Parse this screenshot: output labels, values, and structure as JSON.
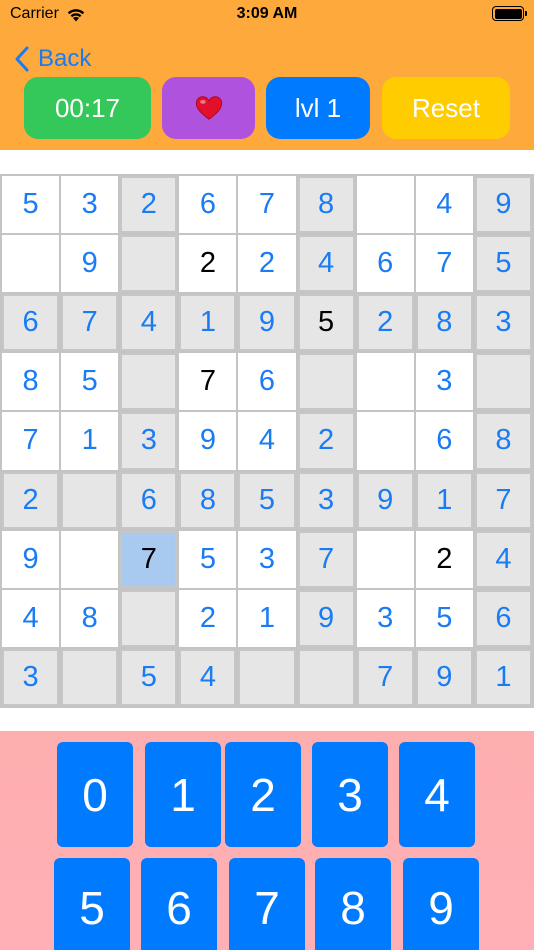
{
  "status_bar": {
    "carrier": "Carrier",
    "time": "3:09 AM"
  },
  "nav": {
    "back_label": "Back"
  },
  "toolbar": {
    "timer": "00:17",
    "favorite_icon": "heart-icon",
    "level": "lvl 1",
    "reset": "Reset"
  },
  "colors": {
    "header": "#fea93b",
    "timer": "#34c759",
    "favorite": "#af52de",
    "level": "#007aff",
    "reset": "#ffcc00",
    "entry_text": "#1a7cf5",
    "given_text": "#000000",
    "selected_cell": "#a8c9f0",
    "shaded_cell": "#e6e6e6",
    "keypad_bg": "#fdaeae",
    "key": "#007aff"
  },
  "board": {
    "rows": [
      [
        {
          "v": "5"
        },
        {
          "v": "3"
        },
        {
          "v": "2",
          "shade": true
        },
        {
          "v": "6"
        },
        {
          "v": "7"
        },
        {
          "v": "8",
          "shade": true
        },
        {
          "v": ""
        },
        {
          "v": "4"
        },
        {
          "v": "9",
          "shade": true
        }
      ],
      [
        {
          "v": ""
        },
        {
          "v": "9"
        },
        {
          "v": "",
          "shade": true
        },
        {
          "v": "2",
          "given": true
        },
        {
          "v": "2"
        },
        {
          "v": "4",
          "shade": true
        },
        {
          "v": "6"
        },
        {
          "v": "7"
        },
        {
          "v": "5",
          "shade": true
        }
      ],
      [
        {
          "v": "6",
          "shade": true
        },
        {
          "v": "7",
          "shade": true
        },
        {
          "v": "4",
          "shade": true
        },
        {
          "v": "1",
          "shade": true
        },
        {
          "v": "9",
          "shade": true
        },
        {
          "v": "5",
          "shade": true,
          "given": true
        },
        {
          "v": "2",
          "shade": true
        },
        {
          "v": "8",
          "shade": true
        },
        {
          "v": "3",
          "shade": true
        }
      ],
      [
        {
          "v": "8"
        },
        {
          "v": "5"
        },
        {
          "v": "",
          "shade": true
        },
        {
          "v": "7",
          "given": true
        },
        {
          "v": "6"
        },
        {
          "v": "",
          "shade": true
        },
        {
          "v": ""
        },
        {
          "v": "3"
        },
        {
          "v": "",
          "shade": true
        }
      ],
      [
        {
          "v": "7"
        },
        {
          "v": "1"
        },
        {
          "v": "3",
          "shade": true
        },
        {
          "v": "9"
        },
        {
          "v": "4"
        },
        {
          "v": "2",
          "shade": true
        },
        {
          "v": ""
        },
        {
          "v": "6"
        },
        {
          "v": "8",
          "shade": true
        }
      ],
      [
        {
          "v": "2",
          "shade": true
        },
        {
          "v": "",
          "shade": true
        },
        {
          "v": "6",
          "shade": true
        },
        {
          "v": "8",
          "shade": true
        },
        {
          "v": "5",
          "shade": true
        },
        {
          "v": "3",
          "shade": true
        },
        {
          "v": "9",
          "shade": true
        },
        {
          "v": "1",
          "shade": true
        },
        {
          "v": "7",
          "shade": true
        }
      ],
      [
        {
          "v": "9"
        },
        {
          "v": ""
        },
        {
          "v": "7",
          "given": true,
          "selected": true
        },
        {
          "v": "5"
        },
        {
          "v": "3"
        },
        {
          "v": "7",
          "shade": true
        },
        {
          "v": ""
        },
        {
          "v": "2",
          "given": true
        },
        {
          "v": "4",
          "shade": true
        }
      ],
      [
        {
          "v": "4"
        },
        {
          "v": "8"
        },
        {
          "v": "",
          "shade": true
        },
        {
          "v": "2"
        },
        {
          "v": "1"
        },
        {
          "v": "9",
          "shade": true
        },
        {
          "v": "3"
        },
        {
          "v": "5"
        },
        {
          "v": "6",
          "shade": true
        }
      ],
      [
        {
          "v": "3",
          "shade": true
        },
        {
          "v": "",
          "shade": true
        },
        {
          "v": "5",
          "shade": true
        },
        {
          "v": "4",
          "shade": true
        },
        {
          "v": "",
          "shade": true
        },
        {
          "v": "",
          "shade": true
        },
        {
          "v": "7",
          "shade": true
        },
        {
          "v": "9",
          "shade": true
        },
        {
          "v": "1",
          "shade": true
        }
      ]
    ]
  },
  "keypad": {
    "row1": [
      "0",
      "1",
      "2",
      "3",
      "4"
    ],
    "row2": [
      "5",
      "6",
      "7",
      "8",
      "9"
    ]
  }
}
